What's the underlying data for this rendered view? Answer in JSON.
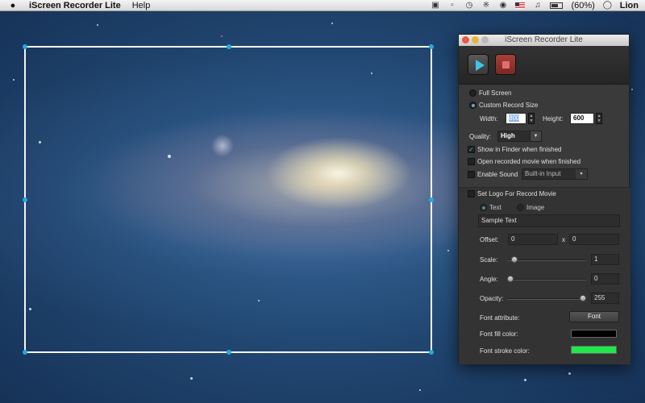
{
  "menubar": {
    "apple": "",
    "app_name": "iScreen Recorder Lite",
    "menus": [
      "Help"
    ],
    "battery_text": "(60%)",
    "user": "Lion"
  },
  "window": {
    "title": "iScreen Recorder Lite",
    "toolbar": {
      "play": "play-icon",
      "stop": "stop-icon"
    },
    "record_mode": {
      "full_screen_label": "Full Screen",
      "custom_label": "Custom Record Size",
      "selected": "custom",
      "width_label": "Width:",
      "width_value": "800",
      "height_label": "Height:",
      "height_value": "600"
    },
    "quality": {
      "label": "Quality:",
      "value": "High"
    },
    "options": {
      "show_in_finder": {
        "label": "Show in Finder when finished",
        "checked": true
      },
      "open_recorded": {
        "label": "Open recorded movie when finished",
        "checked": false
      },
      "enable_sound": {
        "label": "Enable Sound",
        "checked": false,
        "input": "Built-in Input"
      }
    },
    "logo": {
      "label": "Set Logo For Record Movie",
      "checked": false,
      "type_text": "Text",
      "type_image": "Image",
      "sample_text": "Sample Text",
      "offset_label": "Offset:",
      "offset_x": "0",
      "offset_sep": "x",
      "offset_y": "0",
      "scale_label": "Scale:",
      "scale_value": "1",
      "scale_level": 0.05,
      "angle_label": "Angle:",
      "angle_value": "0",
      "angle_level": 0.0,
      "opacity_label": "Opacity:",
      "opacity_value": "255",
      "opacity_level": 1.0,
      "font_attr_label": "Font attribute:",
      "font_button": "Font",
      "fill_label": "Font fill color:",
      "fill_color": "#000000",
      "stroke_label": "Font stroke color:",
      "stroke_color": "#1ee84a"
    }
  }
}
